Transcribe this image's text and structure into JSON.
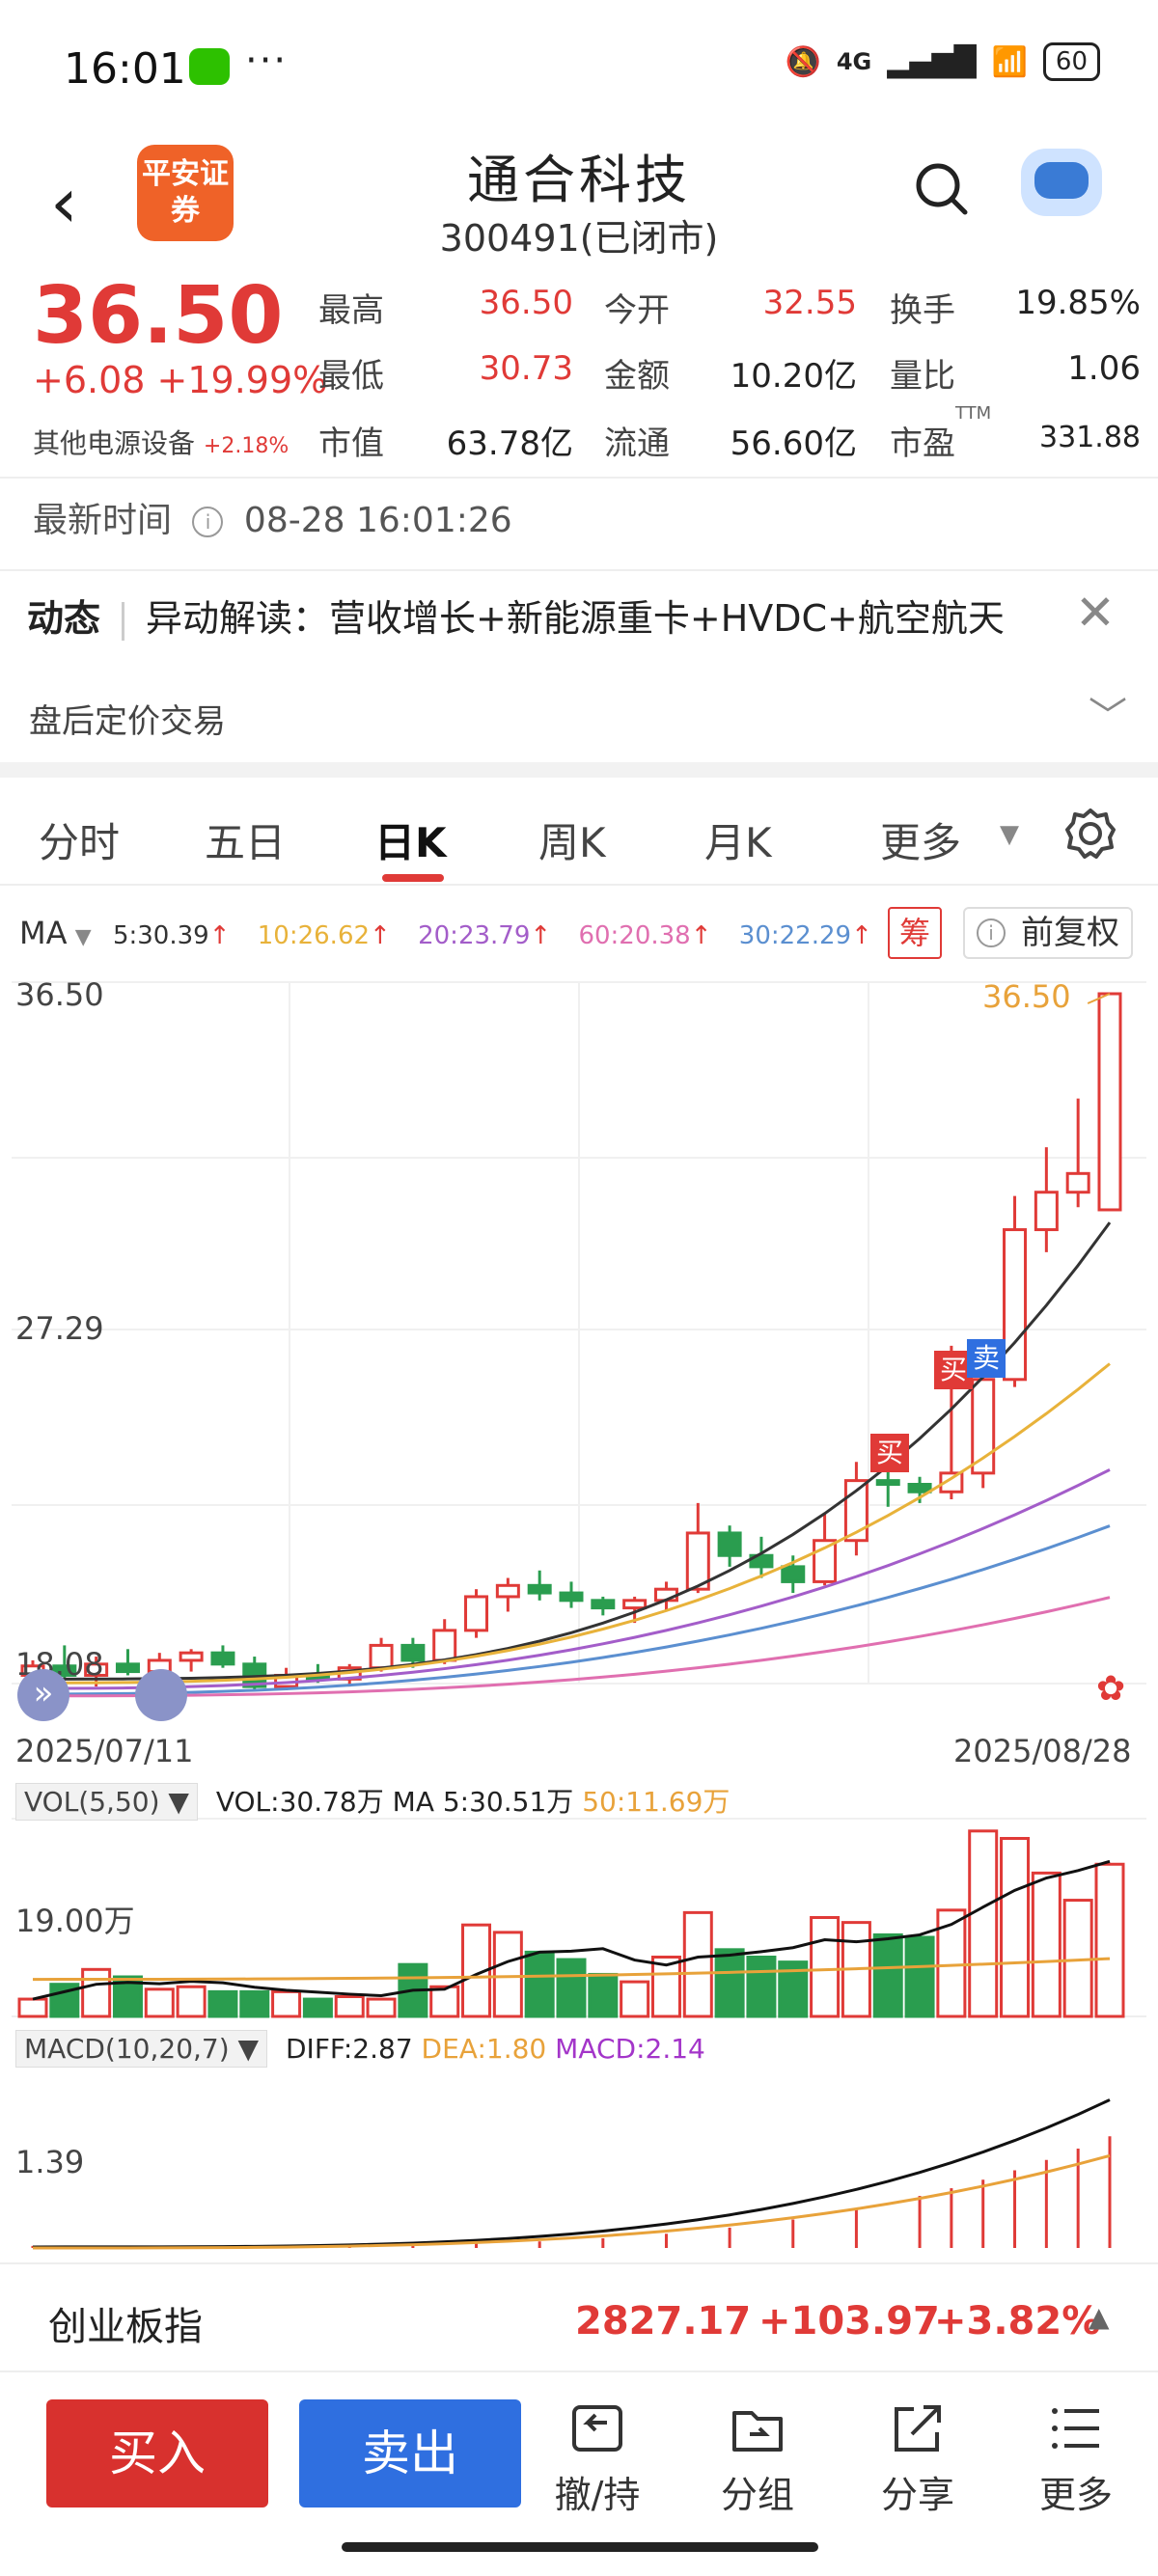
{
  "status": {
    "time": "16:01",
    "dots": "···",
    "network": "4G",
    "battery": "60"
  },
  "header": {
    "logo_text": "平安证券",
    "name": "通合科技",
    "code_status": "300491(已闭市)"
  },
  "quote": {
    "price": "36.50",
    "change": "+6.08 +19.99%",
    "sector_name": "其他电源设备",
    "sector_change": "+2.18%",
    "rows": [
      [
        {
          "l": "最高",
          "v": "36.50",
          "c": "red"
        },
        {
          "l": "今开",
          "v": "32.55",
          "c": "red"
        },
        {
          "l": "换手",
          "v": "19.85%",
          "c": "black"
        }
      ],
      [
        {
          "l": "最低",
          "v": "30.73",
          "c": "red"
        },
        {
          "l": "金额",
          "v": "10.20亿",
          "c": "black"
        },
        {
          "l": "量比",
          "v": "1.06",
          "c": "black"
        }
      ],
      [
        {
          "l": "市值",
          "v": "63.78亿",
          "c": "black"
        },
        {
          "l": "流通",
          "v": "56.60亿",
          "c": "black"
        },
        {
          "l": "市盈",
          "sup": "TTM",
          "v": "331.88",
          "c": "black"
        }
      ]
    ]
  },
  "latest": {
    "label": "最新时间",
    "value": "08-28 16:01:26"
  },
  "dynamic": {
    "tag": "动态",
    "text": "异动解读：营收增长+新能源重卡+HVDC+航空航天"
  },
  "afterhours": "盘后定价交易",
  "tabs": [
    "分时",
    "五日",
    "日K",
    "周K",
    "月K",
    "更多"
  ],
  "ma": {
    "label": "MA",
    "items": [
      {
        "t": "5:30.39",
        "color": "#333333"
      },
      {
        "t": "10:26.62",
        "color": "#e8b23a"
      },
      {
        "t": "20:23.79",
        "color": "#a35dc9"
      },
      {
        "t": "30:22.29",
        "color": "#5b8fd0"
      },
      {
        "t": "60:20.38",
        "color": "#e06fb0"
      }
    ],
    "chou": "筹",
    "fuquan": "前复权"
  },
  "kline": {
    "y_top": "36.50",
    "y_mid": "27.29",
    "y_low": "18.08",
    "date_start": "2025/07/11",
    "date_end": "2025/08/28",
    "high_label": "36.50",
    "buy": "买",
    "sell": "卖"
  },
  "vol": {
    "selector": "VOL(5,50)",
    "vol": "VOL:30.78万",
    "ma5": "MA 5:30.51万",
    "ma50": "50:11.69万",
    "axis": "19.00万"
  },
  "macd": {
    "selector": "MACD(10,20,7)",
    "diff": "DIFF:2.87",
    "dea": "DEA:1.80",
    "macd": "MACD:2.14",
    "axis": "1.39"
  },
  "index": {
    "name": "创业板指",
    "value": "2827.17",
    "change": "+103.97",
    "pct": "+3.82%"
  },
  "toolbar": {
    "buy": "买入",
    "sell": "卖出",
    "hold": "撤/持",
    "group": "分组",
    "share": "分享",
    "more": "更多"
  },
  "colors": {
    "up": "#e03a37",
    "down": "#2a9d4f",
    "accent_blue": "#2f6fe0"
  },
  "chart_data": {
    "type": "candlestick",
    "date_range": [
      "2025/07/11",
      "2025/08/28"
    ],
    "ylim": [
      18.08,
      36.5
    ],
    "candles": [
      {
        "o": 18.3,
        "h": 18.7,
        "l": 17.9,
        "c": 18.55
      },
      {
        "o": 18.55,
        "h": 19.1,
        "l": 18.2,
        "c": 18.3
      },
      {
        "o": 18.3,
        "h": 18.8,
        "l": 18.0,
        "c": 18.6
      },
      {
        "o": 18.6,
        "h": 19.0,
        "l": 18.3,
        "c": 18.4
      },
      {
        "o": 18.4,
        "h": 18.9,
        "l": 18.1,
        "c": 18.7
      },
      {
        "o": 18.7,
        "h": 19.0,
        "l": 18.4,
        "c": 18.9
      },
      {
        "o": 18.9,
        "h": 19.1,
        "l": 18.5,
        "c": 18.6
      },
      {
        "o": 18.6,
        "h": 18.8,
        "l": 17.9,
        "c": 18.0
      },
      {
        "o": 18.0,
        "h": 18.5,
        "l": 17.9,
        "c": 18.3
      },
      {
        "o": 18.3,
        "h": 18.6,
        "l": 18.1,
        "c": 18.2
      },
      {
        "o": 18.2,
        "h": 18.6,
        "l": 18.0,
        "c": 18.5
      },
      {
        "o": 18.5,
        "h": 19.3,
        "l": 18.4,
        "c": 19.1
      },
      {
        "o": 19.1,
        "h": 19.3,
        "l": 18.5,
        "c": 18.7
      },
      {
        "o": 18.7,
        "h": 19.8,
        "l": 18.6,
        "c": 19.5
      },
      {
        "o": 19.5,
        "h": 20.6,
        "l": 19.3,
        "c": 20.4
      },
      {
        "o": 20.4,
        "h": 20.9,
        "l": 20.0,
        "c": 20.7
      },
      {
        "o": 20.7,
        "h": 21.1,
        "l": 20.3,
        "c": 20.5
      },
      {
        "o": 20.5,
        "h": 20.8,
        "l": 20.1,
        "c": 20.3
      },
      {
        "o": 20.3,
        "h": 20.4,
        "l": 19.9,
        "c": 20.1
      },
      {
        "o": 20.1,
        "h": 20.4,
        "l": 19.7,
        "c": 20.3
      },
      {
        "o": 20.3,
        "h": 20.8,
        "l": 20.0,
        "c": 20.6
      },
      {
        "o": 20.6,
        "h": 22.9,
        "l": 20.5,
        "c": 22.1
      },
      {
        "o": 22.1,
        "h": 22.3,
        "l": 21.2,
        "c": 21.5
      },
      {
        "o": 21.5,
        "h": 22.0,
        "l": 20.9,
        "c": 21.2
      },
      {
        "o": 21.2,
        "h": 21.5,
        "l": 20.5,
        "c": 20.8
      },
      {
        "o": 20.8,
        "h": 22.6,
        "l": 20.7,
        "c": 21.9
      },
      {
        "o": 21.9,
        "h": 24.0,
        "l": 21.5,
        "c": 23.5
      },
      {
        "o": 23.5,
        "h": 24.1,
        "l": 22.8,
        "c": 23.4
      },
      {
        "o": 23.4,
        "h": 23.6,
        "l": 22.9,
        "c": 23.2
      },
      {
        "o": 23.2,
        "h": 27.1,
        "l": 23.0,
        "c": 23.7
      },
      {
        "o": 23.7,
        "h": 26.6,
        "l": 23.3,
        "c": 26.2
      },
      {
        "o": 26.2,
        "h": 31.1,
        "l": 26.0,
        "c": 30.2
      },
      {
        "o": 30.2,
        "h": 32.4,
        "l": 29.6,
        "c": 31.2
      },
      {
        "o": 31.2,
        "h": 33.7,
        "l": 30.8,
        "c": 31.7
      },
      {
        "o": 30.73,
        "h": 36.5,
        "l": 30.73,
        "c": 36.5
      }
    ],
    "volume": [
      3.5,
      6.5,
      9.5,
      8.0,
      5.5,
      6.0,
      5.0,
      5.0,
      5.0,
      3.5,
      4.0,
      3.5,
      10.5,
      6.0,
      18.5,
      17.0,
      13.0,
      11.5,
      8.5,
      7.0,
      12.0,
      21.0,
      13.5,
      12.0,
      11.0,
      20.0,
      19.0,
      16.5,
      16.0,
      21.5,
      37.5,
      36.0,
      29.0,
      23.5,
      30.78
    ],
    "ma_lines": {
      "MA5": 30.39,
      "MA10": 26.62,
      "MA20": 23.79,
      "MA30": 22.29,
      "MA60": 20.38
    },
    "macd": {
      "diff": 2.87,
      "dea": 1.8,
      "macd": 2.14
    }
  }
}
